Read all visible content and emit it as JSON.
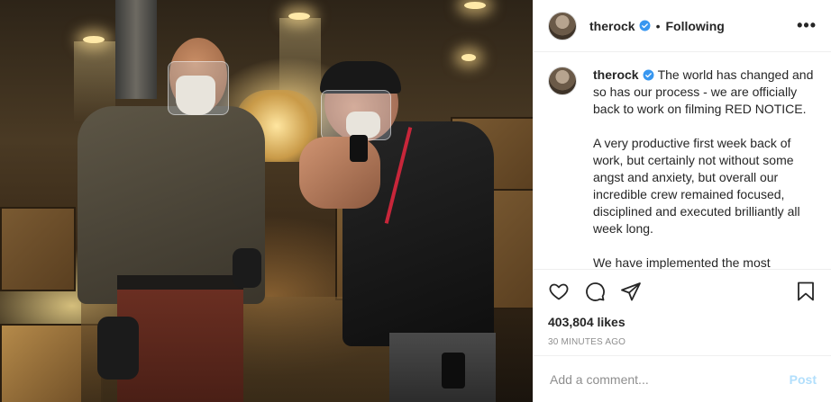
{
  "photo": {
    "alt_visible": ""
  },
  "header": {
    "username": "therock",
    "separator": "•",
    "follow_status": "Following",
    "more_icon": "more-horizontal-icon"
  },
  "caption": {
    "username": "therock",
    "paragraphs": [
      "The world has changed and so has our process - we are officially back to work on filming RED NOTICE.",
      "A very productive first week back of work, but certainly not without some angst and anxiety, but overall our incredible crew remained focused, disciplined and executed brilliantly all week long.",
      "We have implemented the most"
    ]
  },
  "actions": {
    "like_icon": "heart-icon",
    "comment_icon": "comment-icon",
    "share_icon": "share-icon",
    "save_icon": "bookmark-icon"
  },
  "likes": "403,804 likes",
  "timestamp": "30 MINUTES AGO",
  "comment_box": {
    "placeholder": "Add a comment...",
    "post_label": "Post"
  },
  "colors": {
    "verified_blue": "#3897f0",
    "post_button": "#b2dffc",
    "muted_text": "#8e8e8e"
  }
}
